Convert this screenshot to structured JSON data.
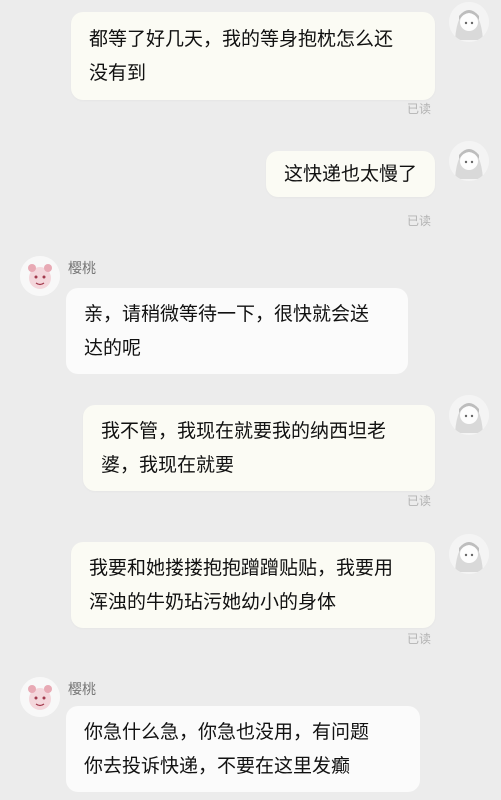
{
  "messages": [
    {
      "text": "都等了好几天，我的等身抱枕怎么还\n没有到",
      "status": "已读"
    },
    {
      "text": "这快递也太慢了",
      "status": "已读"
    },
    {
      "sender": "樱桃",
      "text": "亲，请稍微等待一下，很快就会送\n达的呢"
    },
    {
      "text": "我不管，我现在就要我的纳西坦老\n婆，我现在就要",
      "status": "已读"
    },
    {
      "text": "我要和她搂搂抱抱蹭蹭贴贴，我要用\n浑浊的牛奶玷污她幼小的身体",
      "status": "已读"
    },
    {
      "sender": "樱桃",
      "text": "你急什么急，你急也没用，有问题\n你去投诉快递，不要在这里发癫"
    }
  ],
  "avatars": {
    "user_icon": "anime-girl-avatar-icon",
    "bot_icon": "pink-cartoon-avatar-icon"
  },
  "colors": {
    "background": "#ececec",
    "user_bubble": "#fbfbf4",
    "bot_bubble": "#fbfbfb",
    "read_label": "#b3b3b3"
  }
}
